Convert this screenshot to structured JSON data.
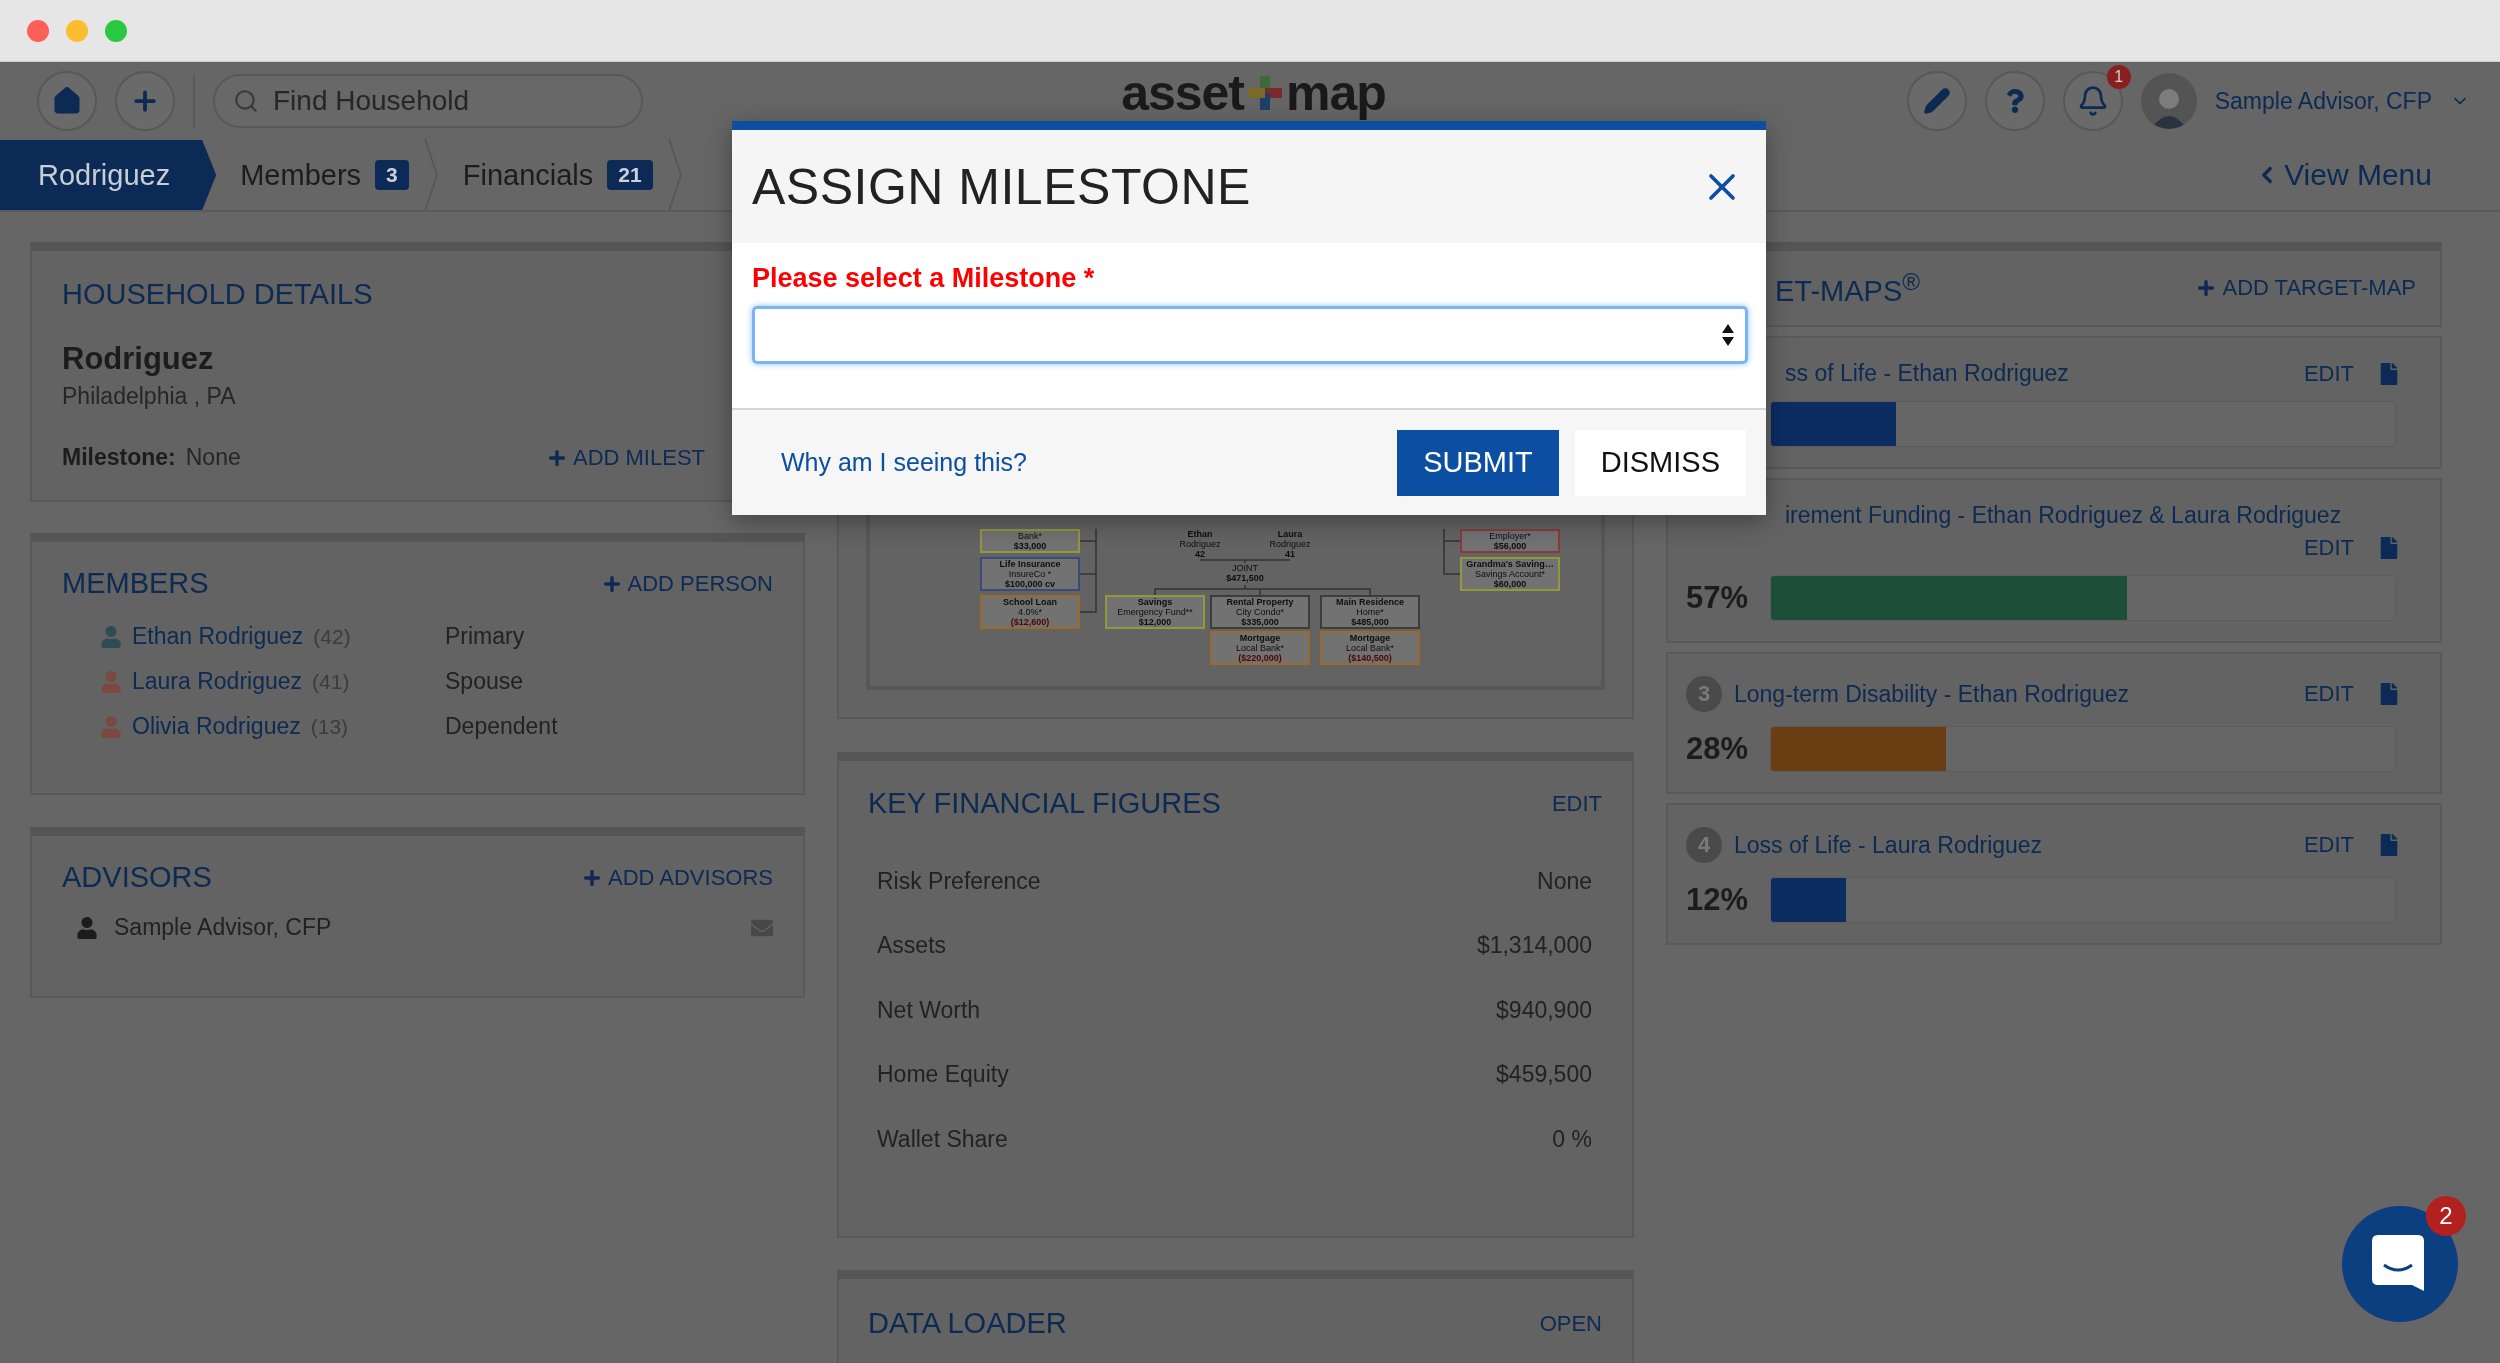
{
  "header": {
    "search": {
      "placeholder": "Find Household"
    },
    "logo": {
      "left": "asset",
      "right": "map"
    },
    "notifications": {
      "badge": "1"
    },
    "user": {
      "name": "Sample Advisor, CFP"
    }
  },
  "tabs": [
    {
      "label": "Rodriguez",
      "selected": true
    },
    {
      "label": "Members",
      "count": "3",
      "selected": false
    },
    {
      "label": "Financials",
      "count": "21",
      "selected": false
    }
  ],
  "view_menu": "View Menu",
  "household": {
    "title": "HOUSEHOLD DETAILS",
    "name": "Rodriguez",
    "location": "Philadelphia , PA",
    "milestone_label": "Milestone:",
    "milestone_value": "None",
    "action": "ADD MILEST"
  },
  "members": {
    "title": "MEMBERS",
    "action": "ADD PERSON",
    "people": [
      {
        "name": "Ethan Rodriguez",
        "age": "(42)",
        "role": "Primary",
        "color": "#2f4c55"
      },
      {
        "name": "Laura Rodriguez",
        "age": "(41)",
        "role": "Spouse",
        "color": "#7a4a40"
      },
      {
        "name": "Olivia Rodriguez",
        "age": "(13)",
        "role": "Dependent",
        "color": "#7a4a40"
      }
    ]
  },
  "advisors": {
    "title": "ADVISORS",
    "action": "ADD ADVISORS",
    "people": [
      {
        "name": "Sample Advisor, CFP"
      }
    ]
  },
  "diagram": {
    "nodes": [
      {
        "kind": "asset",
        "color": "#8f9a3c",
        "lines": [
          "Bank*",
          "$33,000"
        ]
      },
      {
        "kind": "insurance",
        "color": "#3b4a78",
        "lines": [
          "Life Insurance",
          "InsureCo *",
          "$100,000 cv"
        ]
      },
      {
        "kind": "liability",
        "color": "#9a6a2a",
        "lines": [
          "School Loan",
          "4.0%*",
          "($12,600)"
        ]
      },
      {
        "kind": "label",
        "lines": [
          "Ethan",
          "Rodriguez",
          "42"
        ]
      },
      {
        "kind": "label",
        "lines": [
          "Laura",
          "Rodriguez",
          "41"
        ]
      },
      {
        "kind": "label",
        "lines": [
          "JOINT",
          "$471,500"
        ]
      },
      {
        "kind": "asset",
        "color": "#8f9a3c",
        "lines": [
          "Savings",
          "Emergency Fund**",
          "$12,000"
        ]
      },
      {
        "kind": "house",
        "color": "#3c3c3c",
        "lines": [
          "Rental Property",
          "City Condo*",
          "$335,000"
        ]
      },
      {
        "kind": "liability",
        "color": "#9a6a2a",
        "lines": [
          "Mortgage",
          "Local Bank*",
          "($220,000)"
        ]
      },
      {
        "kind": "house",
        "color": "#3c3c3c",
        "lines": [
          "Main Residence",
          "Home*",
          "$485,000"
        ]
      },
      {
        "kind": "liability",
        "color": "#9a6a2a",
        "lines": [
          "Mortgage",
          "Local Bank*",
          "($140,500)"
        ]
      },
      {
        "kind": "asset",
        "color": "#8a3a3a",
        "lines": [
          "Employer*",
          "$56,000"
        ]
      },
      {
        "kind": "asset",
        "color": "#8f9a3c",
        "lines": [
          "Grandma's Saving…",
          "Savings Account*",
          "$60,000"
        ]
      }
    ]
  },
  "key_figures": {
    "title": "KEY FINANCIAL FIGURES",
    "action": "EDIT",
    "rows": [
      {
        "label": "Risk Preference",
        "value": "None"
      },
      {
        "label": "Assets",
        "value": "$1,314,000"
      },
      {
        "label": "Net Worth",
        "value": "$940,900"
      },
      {
        "label": "Home Equity",
        "value": "$459,500"
      },
      {
        "label": "Wallet Share",
        "value": "0 %"
      }
    ]
  },
  "data_loader": {
    "title": "DATA LOADER",
    "action": "OPEN"
  },
  "target_maps": {
    "title": "ET-MAPS$^{®}$",
    "action": "ADD TARGET-MAP",
    "items": [
      {
        "title": "ss of Life - Ethan Rodriguez",
        "action": "EDIT",
        "level": 0.2,
        "color": "#0b2d62"
      },
      {
        "title": "irement Funding - Ethan Rodriguez & Laura Rodriguez",
        "action": "EDIT",
        "percent": "57%",
        "level": 0.57,
        "color": "#1d4f38"
      },
      {
        "number": "3",
        "title": "Long-term Disability - Ethan Rodriguez",
        "action": "EDIT",
        "percent": "28%",
        "level": 0.28,
        "color": "#6a3d12"
      },
      {
        "number": "4",
        "title": "Loss of Life - Laura Rodriguez",
        "action": "EDIT",
        "percent": "12%",
        "level": 0.12,
        "color": "#0b2d62"
      }
    ]
  },
  "modal": {
    "title": "ASSIGN MILESTONE",
    "label": "Please select a Milestone *",
    "help_link": "Why am I seeing this?",
    "buttons": [
      {
        "label": "SUBMIT",
        "kind": "primary"
      },
      {
        "label": "DISMISS",
        "kind": "secondary"
      }
    ]
  },
  "chat": {
    "badge": "2"
  }
}
